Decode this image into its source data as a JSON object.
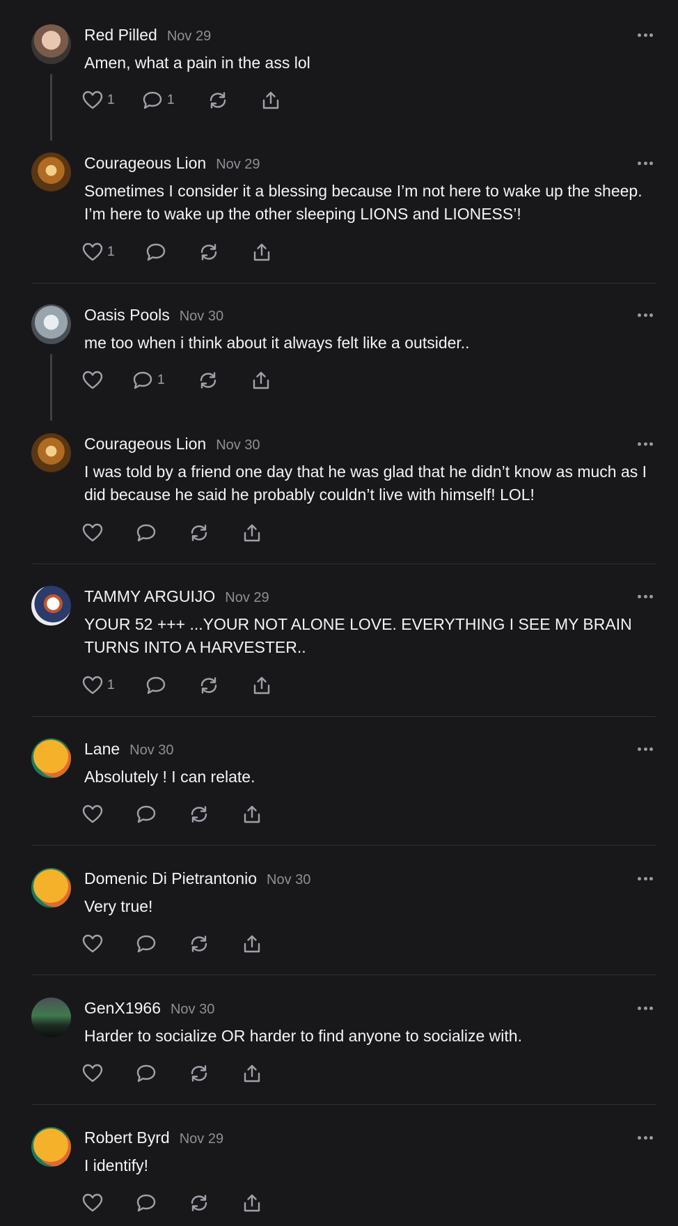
{
  "colors": {
    "background": "#18181b",
    "text": "#f4f4f5",
    "muted": "#8e8e95",
    "divider": "#303036"
  },
  "posts": [
    {
      "author": "Red Pilled",
      "date": "Nov 29",
      "text": "Amen, what a pain in the ass lol",
      "likes": "1",
      "replies": "1",
      "avatar": "photo-woman"
    },
    {
      "author": "Courageous Lion",
      "date": "Nov 29",
      "text": "Sometimes I consider it a blessing because I’m not here to wake up the sheep. I’m here to wake up the other sleeping LIONS and LIONESS’!",
      "likes": "1",
      "replies": "",
      "avatar": "lion"
    },
    {
      "author": "Oasis Pools",
      "date": "Nov 30",
      "text": "me too when i think about it always felt like a outsider..",
      "likes": "",
      "replies": "1",
      "avatar": "wolf"
    },
    {
      "author": "Courageous Lion",
      "date": "Nov 30",
      "text": "I was told by a friend one day that he was glad that he didn’t know as much as I did because he said he probably couldn’t live with himself! LOL!",
      "likes": "",
      "replies": "",
      "avatar": "lion"
    },
    {
      "author": "TAMMY ARGUIJO",
      "date": "Nov 29",
      "text": "YOUR 52 +++ ...YOUR NOT ALONE LOVE. EVERYTHING I SEE MY BRAIN TURNS INTO A HARVESTER..",
      "likes": "1",
      "replies": "",
      "avatar": "person"
    },
    {
      "author": "Lane",
      "date": "Nov 30",
      "text": "Absolutely ! I can relate.",
      "likes": "",
      "replies": "",
      "avatar": "default"
    },
    {
      "author": "Domenic Di Pietrantonio",
      "date": "Nov 30",
      "text": "Very true!",
      "likes": "",
      "replies": "",
      "avatar": "default"
    },
    {
      "author": "GenX1966",
      "date": "Nov 30",
      "text": "Harder to socialize OR harder to find anyone to socialize with.",
      "likes": "",
      "replies": "",
      "avatar": "aurora"
    },
    {
      "author": "Robert Byrd",
      "date": "Nov 29",
      "text": "I identify!",
      "likes": "",
      "replies": "",
      "avatar": "default"
    }
  ]
}
